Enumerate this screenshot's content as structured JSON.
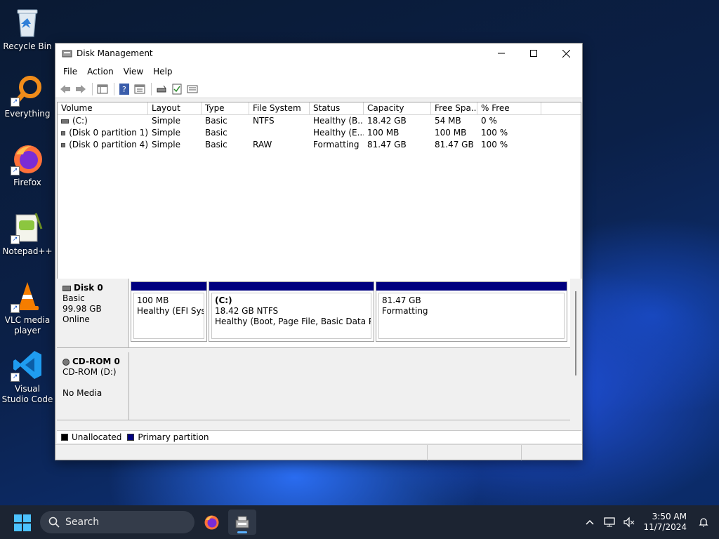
{
  "desktop": {
    "icons": [
      {
        "label": "Recycle Bin"
      },
      {
        "label": "Everything"
      },
      {
        "label": "Firefox"
      },
      {
        "label": "Notepad++"
      },
      {
        "label": "VLC media player"
      },
      {
        "label": "Visual Studio Code"
      }
    ]
  },
  "window": {
    "title": "Disk Management",
    "menus": [
      "File",
      "Action",
      "View",
      "Help"
    ],
    "columns": [
      "Volume",
      "Layout",
      "Type",
      "File System",
      "Status",
      "Capacity",
      "Free Spa...",
      "% Free"
    ],
    "volumes": [
      {
        "volume": "(C:)",
        "layout": "Simple",
        "type": "Basic",
        "fs": "NTFS",
        "status": "Healthy (B...",
        "capacity": "18.42 GB",
        "free": "54 MB",
        "pct": "0 %"
      },
      {
        "volume": "(Disk 0 partition 1)",
        "layout": "Simple",
        "type": "Basic",
        "fs": "",
        "status": "Healthy (E...",
        "capacity": "100 MB",
        "free": "100 MB",
        "pct": "100 %"
      },
      {
        "volume": "(Disk 0 partition 4)",
        "layout": "Simple",
        "type": "Basic",
        "fs": "RAW",
        "status": "Formatting",
        "capacity": "81.47 GB",
        "free": "81.47 GB",
        "pct": "100 %"
      }
    ],
    "disk0": {
      "name": "Disk 0",
      "kind": "Basic",
      "size": "99.98 GB",
      "state": "Online",
      "partitions": [
        {
          "name": "",
          "size": "100 MB",
          "status": "Healthy (EFI System Partition)"
        },
        {
          "name": "(C:)",
          "size": "18.42 GB NTFS",
          "status": "Healthy (Boot, Page File, Basic Data Partition)"
        },
        {
          "name": "",
          "size": "81.47 GB",
          "status": "Formatting"
        }
      ]
    },
    "cdrom": {
      "name": "CD-ROM 0",
      "drive": "CD-ROM (D:)",
      "media": "No Media"
    },
    "legend": [
      {
        "label": "Unallocated",
        "color": "#000000"
      },
      {
        "label": "Primary partition",
        "color": "#00007f"
      }
    ]
  },
  "taskbar": {
    "search_placeholder": "Search",
    "time": "3:50 AM",
    "date": "11/7/2024"
  }
}
